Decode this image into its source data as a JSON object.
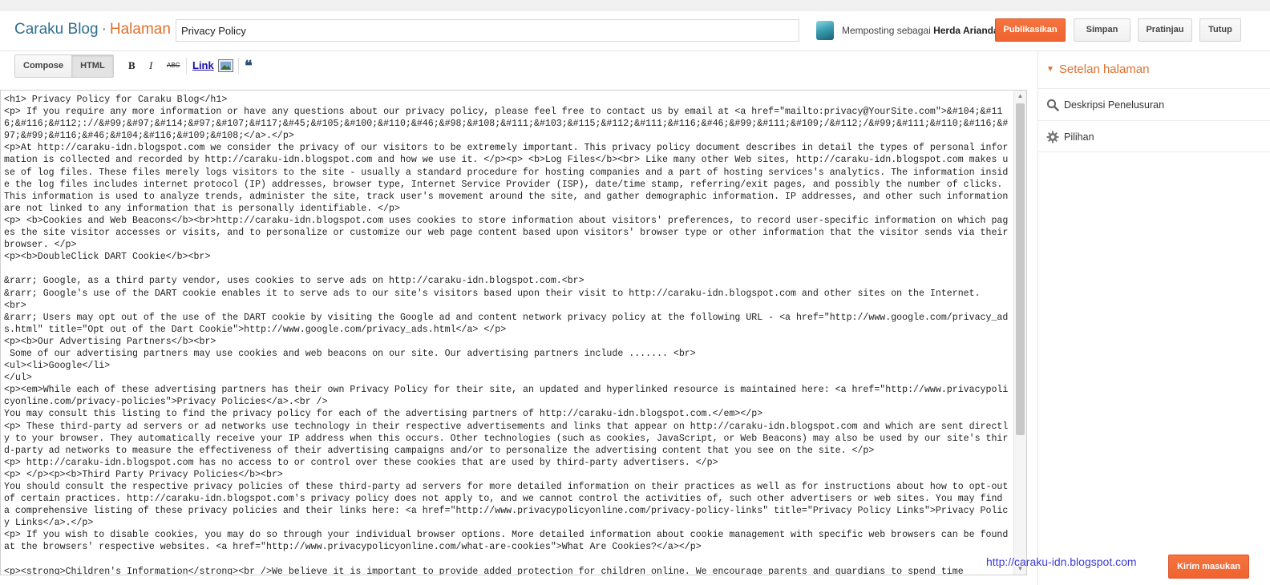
{
  "header": {
    "blog_name": "Caraku Blog",
    "separator": "·",
    "section": "Halaman",
    "title_value": "Privacy Policy",
    "posting_as_prefix": "Memposting sebagai",
    "posting_as_user": "Herda Arianda",
    "buttons": {
      "publish": "Publikasikan",
      "save": "Simpan",
      "preview": "Pratinjau",
      "close": "Tutup"
    }
  },
  "toolbar": {
    "compose": "Compose",
    "html": "HTML",
    "bold": "B",
    "italic": "I",
    "strike": "ABC",
    "link": "Link",
    "quote": "❝"
  },
  "editor": {
    "content": "<h1> Privacy Policy for Caraku Blog</h1>\n<p> If you require any more information or have any questions about our privacy policy, please feel free to contact us by email at <a href=\"mailto:privacy@YourSite.com\">&#104;&#116;&#116;&#112;://&#99;&#97;&#114;&#97;&#107;&#117;&#45;&#105;&#100;&#110;&#46;&#98;&#108;&#111;&#103;&#115;&#112;&#111;&#116;&#46;&#99;&#111;&#109;/&#112;/&#99;&#111;&#110;&#116;&#97;&#99;&#116;&#46;&#104;&#116;&#109;&#108;</a>.</p>\n<p>At http://caraku-idn.blogspot.com we consider the privacy of our visitors to be extremely important. This privacy policy document describes in detail the types of personal information is collected and recorded by http://caraku-idn.blogspot.com and how we use it. </p><p> <b>Log Files</b><br> Like many other Web sites, http://caraku-idn.blogspot.com makes use of log files. These files merely logs visitors to the site - usually a standard procedure for hosting companies and a part of hosting services's analytics. The information inside the log files includes internet protocol (IP) addresses, browser type, Internet Service Provider (ISP), date/time stamp, referring/exit pages, and possibly the number of clicks. This information is used to analyze trends, administer the site, track user's movement around the site, and gather demographic information. IP addresses, and other such information are not linked to any information that is personally identifiable. </p>\n<p> <b>Cookies and Web Beacons</b><br>http://caraku-idn.blogspot.com uses cookies to store information about visitors' preferences, to record user-specific information on which pages the site visitor accesses or visits, and to personalize or customize our web page content based upon visitors' browser type or other information that the visitor sends via their browser. </p>\n<p><b>DoubleClick DART Cookie</b><br>\n\n&rarr; Google, as a third party vendor, uses cookies to serve ads on http://caraku-idn.blogspot.com.<br>\n&rarr; Google's use of the DART cookie enables it to serve ads to our site's visitors based upon their visit to http://caraku-idn.blogspot.com and other sites on the Internet.\n<br>\n&rarr; Users may opt out of the use of the DART cookie by visiting the Google ad and content network privacy policy at the following URL - <a href=\"http://www.google.com/privacy_ads.html\" title=\"Opt out of the Dart Cookie\">http://www.google.com/privacy_ads.html</a> </p>\n<p><b>Our Advertising Partners</b><br>\n Some of our advertising partners may use cookies and web beacons on our site. Our advertising partners include ....... <br>\n<ul><li>Google</li>\n</ul>\n<p><em>While each of these advertising partners has their own Privacy Policy for their site, an updated and hyperlinked resource is maintained here: <a href=\"http://www.privacypolicyonline.com/privacy-policies\">Privacy Policies</a>.<br />\nYou may consult this listing to find the privacy policy for each of the advertising partners of http://caraku-idn.blogspot.com.</em></p>\n<p> These third-party ad servers or ad networks use technology in their respective advertisements and links that appear on http://caraku-idn.blogspot.com and which are sent directly to your browser. They automatically receive your IP address when this occurs. Other technologies (such as cookies, JavaScript, or Web Beacons) may also be used by our site's third-party ad networks to measure the effectiveness of their advertising campaigns and/or to personalize the advertising content that you see on the site. </p>\n<p> http://caraku-idn.blogspot.com has no access to or control over these cookies that are used by third-party advertisers. </p>\n<p> </p><p><b>Third Party Privacy Policies</b><br>\nYou should consult the respective privacy policies of these third-party ad servers for more detailed information on their practices as well as for instructions about how to opt-out of certain practices. http://caraku-idn.blogspot.com's privacy policy does not apply to, and we cannot control the activities of, such other advertisers or web sites. You may find a comprehensive listing of these privacy policies and their links here: <a href=\"http://www.privacypolicyonline.com/privacy-policy-links\" title=\"Privacy Policy Links\">Privacy Policy Links</a>.</p>\n<p> If you wish to disable cookies, you may do so through your individual browser options. More detailed information about cookie management with specific web browsers can be found at the browsers' respective websites. <a href=\"http://www.privacypolicyonline.com/what-are-cookies\">What Are Cookies?</a></p>\n\n<p><strong>Children's Information</strong><br />We believe it is important to provide added protection for children online. We encourage parents and guardians to spend time"
  },
  "sidebar": {
    "heading": "Setelan halaman",
    "items": [
      {
        "label": "Deskripsi Penelusuran",
        "icon": "search-icon"
      },
      {
        "label": "Pilihan",
        "icon": "gear-icon"
      }
    ]
  },
  "watermark": "http://caraku-idn.blogspot.com",
  "feedback_button": "Kirim masukan",
  "colors": {
    "accent_orange": "#ef6330",
    "brand_blue": "#2f6f8f",
    "watermark_blue": "#3d3dd8"
  }
}
